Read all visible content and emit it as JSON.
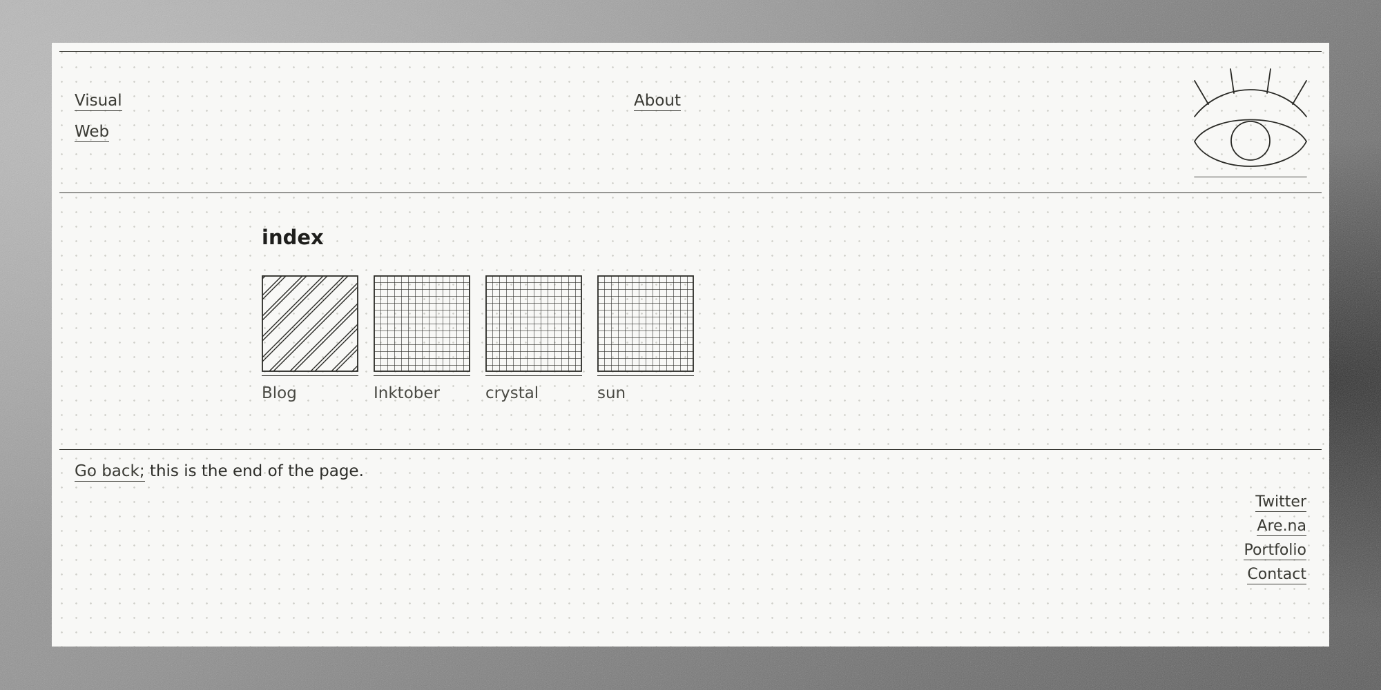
{
  "nav": {
    "visual": "Visual",
    "web": "Web",
    "about": "About"
  },
  "logo": {
    "icon": "eye-icon"
  },
  "index": {
    "title": "index",
    "items": [
      {
        "label": "Blog",
        "pattern": "diagonal-stripes"
      },
      {
        "label": "Inktober",
        "pattern": "grid"
      },
      {
        "label": "crystal",
        "pattern": "grid"
      },
      {
        "label": "sun",
        "pattern": "grid"
      }
    ]
  },
  "footer": {
    "go_back": "Go back;",
    "end_text": " this is the end of the page.",
    "links": [
      "Twitter",
      "Are.na",
      "Portfolio",
      "Contact"
    ]
  },
  "colors": {
    "page_bg": "#f8f8f6",
    "ink": "#2a2a26",
    "backdrop": "#8c8c8c"
  }
}
